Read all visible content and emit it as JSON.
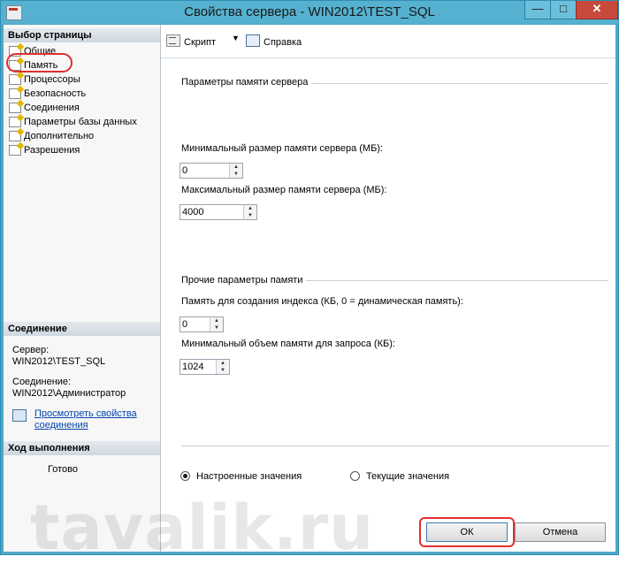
{
  "window": {
    "title": "Свойства сервера - WIN2012\\TEST_SQL",
    "controls": {
      "minimize": "—",
      "maximize": "□",
      "close": "✕"
    }
  },
  "sidebar": {
    "header": "Выбор страницы",
    "items": [
      {
        "label": "Общие"
      },
      {
        "label": "Память"
      },
      {
        "label": "Процессоры"
      },
      {
        "label": "Безопасность"
      },
      {
        "label": "Соединения"
      },
      {
        "label": "Параметры базы данных"
      },
      {
        "label": "Дополнительно"
      },
      {
        "label": "Разрешения"
      }
    ],
    "selected": "Память"
  },
  "connection": {
    "header": "Соединение",
    "server_label": "Сервер:",
    "server_value": "WIN2012\\TEST_SQL",
    "connection_label": "Соединение:",
    "connection_value": "WIN2012\\Администратор",
    "view_link": "Просмотреть свойства соединения"
  },
  "progress": {
    "header": "Ход выполнения",
    "status": "Готово"
  },
  "toolbar": {
    "script_label": "Скрипт",
    "help_label": "Справка"
  },
  "memory": {
    "server_group": "Параметры памяти сервера",
    "min_label": "Минимальный размер памяти сервера (МБ):",
    "min_value": "0",
    "max_label": "Максимальный размер памяти сервера (МБ):",
    "max_value": "4000",
    "other_group": "Прочие параметры памяти",
    "index_label": "Память для создания индекса (КБ, 0 = динамическая память):",
    "index_value": "0",
    "query_label": "Минимальный объем памяти для запроса (КБ):",
    "query_value": "1024"
  },
  "values_mode": {
    "configured_label": "Настроенные значения",
    "running_label": "Текущие значения",
    "selected": "configured"
  },
  "buttons": {
    "ok_label": "ОК",
    "cancel_label": "Отмена"
  },
  "watermark": "tavalik.ru",
  "colors": {
    "accent": "#4fa7c6",
    "highlight": "#e03030",
    "link": "#0645ad"
  }
}
